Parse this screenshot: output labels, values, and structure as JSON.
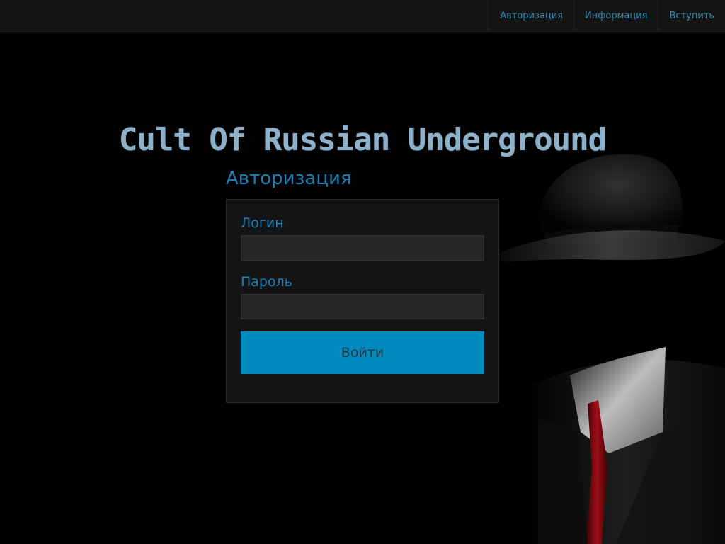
{
  "nav": {
    "items": [
      {
        "label": "Авторизация"
      },
      {
        "label": "Информация"
      },
      {
        "label": "Вступить"
      }
    ]
  },
  "site": {
    "title": "Cult Of Russian Underground"
  },
  "login": {
    "heading": "Авторизация",
    "login_label": "Логин",
    "login_value": "",
    "password_label": "Пароль",
    "password_value": "",
    "submit_label": "Войти"
  },
  "colors": {
    "accent": "#008abd",
    "link": "#2a88b4",
    "title": "#8fb0c9",
    "background": "#000000",
    "panel": "#141414"
  },
  "icons": [
    "faceless-man-figure"
  ]
}
